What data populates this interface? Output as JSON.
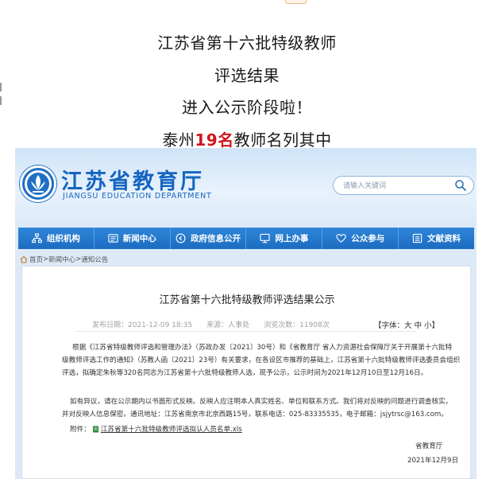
{
  "headline": {
    "line1": "江苏省第十六批特级教师",
    "line2": "评选结果",
    "line3": "进入公示阶段啦！",
    "line4_prefix": "泰州",
    "line4_highlight": "19名",
    "line4_suffix": "教师名列其中",
    "highlight_color": "#d0161b"
  },
  "site": {
    "title": "江苏省教育厅",
    "subtitle": "JIANGSU EDUCATION DEPARTMENT",
    "brand_color": "#1565c0",
    "search_placeholder": "请输入关键词",
    "search_icon": "search-icon"
  },
  "nav": [
    {
      "label": "组织机构",
      "icon": "org-chart-icon"
    },
    {
      "label": "新闻中心",
      "icon": "news-icon"
    },
    {
      "label": "政府信息公开",
      "icon": "info-disclosure-icon"
    },
    {
      "label": "网上办事",
      "icon": "monitor-icon"
    },
    {
      "label": "公众参与",
      "icon": "heart-icon"
    },
    {
      "label": "文献资料",
      "icon": "documents-icon"
    }
  ],
  "breadcrumb": {
    "home": "首页",
    "sep1": ">",
    "news": "新闻中心",
    "sep2": ">",
    "current": "通知公告"
  },
  "article": {
    "title": "江苏省第十六批特级教师评选结果公示",
    "meta": "发布日期：2021-12-09 18:35　　来源：人事处　　浏览次数：11908次",
    "font_size_label": "【字体：大 中 小】",
    "p1": "根据《江苏省特级教师评选和管理办法》（苏政办发〔2021〕30号）和《省教育厅 省人力资源社会保障厅关于开展第十六批特",
    "p2": "级教师评选工作的通知》（苏教人函〔2021〕23号）有关要求，在各设区市推荐的基础上，江苏省第十六批特级教师评选委员会组织",
    "p3": "评选，拟确定朱秋等320名同志为江苏省第十六批特级教师人选，现予公示，公示时间为2021年12月10日至12月16日。",
    "p4": "",
    "p5": "如有异议，请在公示期内以书面形式反映。反映人应注明本人真实姓名、单位和联系方式。我们将对反映的问题进行调查核实，",
    "p6": "并对反映人信息保密。通讯地址：江苏省南京市北京西路15号，联系电话：025-83335535，电子邮箱：jsjytrsc@163.com。",
    "attachment_label": "附件：",
    "attachment_icon": "file-icon",
    "attachment_name": "江苏省第十六批特级教师评选拟认人员名单.xls",
    "sign_org": "省教育厅",
    "sign_date": "2021年12月9日"
  }
}
